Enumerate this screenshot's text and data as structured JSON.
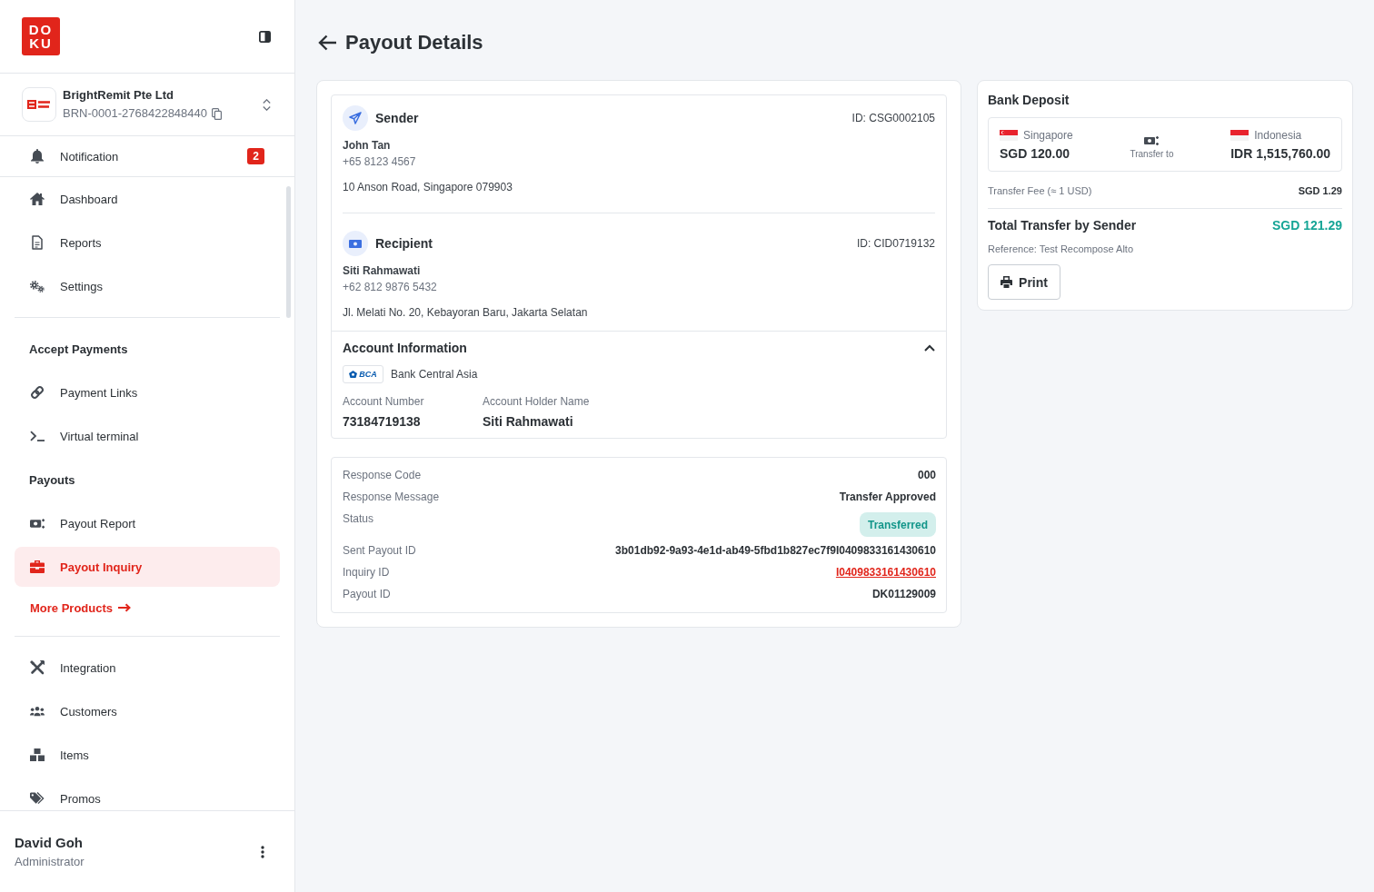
{
  "sidebar": {
    "logo_text": [
      "DO",
      "KU"
    ],
    "merchant": {
      "name": "BrightRemit Pte Ltd",
      "id": "BRN-0001-2768422848440"
    },
    "notification": {
      "label": "Notification",
      "count": "2"
    },
    "nav_sections": [
      [
        {
          "kind": "item",
          "label": "Dashboard",
          "selected": false
        },
        {
          "kind": "item",
          "label": "Reports",
          "selected": false
        },
        {
          "kind": "item",
          "label": "Settings",
          "selected": false
        }
      ],
      [
        {
          "kind": "heading",
          "label": "Accept Payments"
        },
        {
          "kind": "item",
          "label": "Payment Links",
          "selected": false
        },
        {
          "kind": "item",
          "label": "Virtual terminal",
          "selected": false
        },
        {
          "kind": "heading",
          "label": "Payouts"
        },
        {
          "kind": "item",
          "label": "Payout Report",
          "selected": false
        },
        {
          "kind": "item",
          "label": "Payout Inquiry",
          "selected": true
        },
        {
          "kind": "link",
          "label": "More Products"
        }
      ],
      [
        {
          "kind": "item",
          "label": "Integration",
          "selected": false
        },
        {
          "kind": "item",
          "label": "Customers",
          "selected": false
        },
        {
          "kind": "item",
          "label": "Items",
          "selected": false
        },
        {
          "kind": "item",
          "label": "Promos",
          "selected": false
        }
      ]
    ],
    "user": {
      "name": "David Goh",
      "role": "Administrator"
    }
  },
  "page": {
    "title": "Payout Details"
  },
  "parties": [
    {
      "heading": "Sender",
      "id": "ID: CSG0002105",
      "name": "John Tan",
      "phone": "+65 8123 4567",
      "address": "10 Anson Road, Singapore 079903"
    },
    {
      "heading": "Recipient",
      "id": "ID: CID0719132",
      "name": "Siti Rahmawati",
      "phone": "+62 812 9876 5432",
      "address": "Jl. Melati No. 20, Kebayoran Baru, Jakarta Selatan"
    }
  ],
  "account_information": {
    "title": "Account Information",
    "expanded": true,
    "bank_logo_text": "BCA",
    "bank_name": "Bank Central Asia",
    "fields": [
      {
        "label": "Account Number",
        "value": "73184719138"
      },
      {
        "label": "Account Holder Name",
        "value": "Siti Rahmawati"
      }
    ]
  },
  "response": [
    {
      "kind": "text",
      "label": "Response Code",
      "value": "000"
    },
    {
      "kind": "text",
      "label": "Response Message",
      "value": "Transfer Approved"
    },
    {
      "kind": "badge",
      "label": "Status",
      "value": "Transferred"
    },
    {
      "kind": "text",
      "label": "Sent Payout ID",
      "value": "3b01db92-9a93-4e1d-ab49-5fbd1b827ec7f9I0409833161430610"
    },
    {
      "kind": "link",
      "label": "Inquiry ID",
      "value": "I0409833161430610"
    },
    {
      "kind": "text",
      "label": "Payout ID",
      "value": "DK01129009"
    }
  ],
  "bank_deposit": {
    "title": "Bank Deposit",
    "from": {
      "country": "Singapore",
      "amount": "SGD 120.00"
    },
    "transfer_label": "Transfer to",
    "to": {
      "country": "Indonesia",
      "amount": "IDR 1,515,760.00"
    },
    "fee": {
      "label": "Transfer Fee (≈ 1 USD)",
      "value": "SGD 1.29"
    },
    "total": {
      "label": "Total Transfer by Sender",
      "value": "SGD 121.29"
    },
    "reference": "Reference: Test Recompose Alto",
    "print_button": "Print"
  }
}
